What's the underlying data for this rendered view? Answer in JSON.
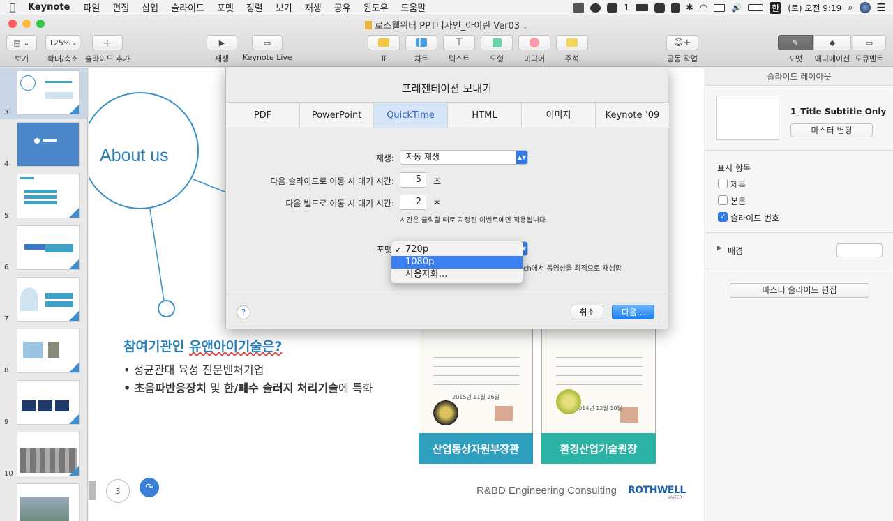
{
  "menubar": {
    "app": "Keynote",
    "items": [
      "파일",
      "편집",
      "삽입",
      "슬라이드",
      "포맷",
      "정렬",
      "보기",
      "재생",
      "공유",
      "윈도우",
      "도움말"
    ],
    "notif_count": "1",
    "ime": "한",
    "clock": "(토) 오전 9:19"
  },
  "window": {
    "title": "로스웰워터 PPT디자인_아이린 Ver03"
  },
  "toolbar": {
    "view_label": "보기",
    "zoom_value": "125%",
    "zoom_label": "확대/축소",
    "add_slide_label": "슬라이드 추가",
    "play_label": "재생",
    "keynote_live_label": "Keynote Live",
    "table_label": "표",
    "chart_label": "차트",
    "text_label": "텍스트",
    "shape_label": "도형",
    "media_label": "미디어",
    "comment_label": "주석",
    "collab_label": "공동 작업",
    "format_label": "포맷",
    "animate_label": "애니메이션",
    "document_label": "도큐멘트"
  },
  "slides": {
    "numbers": [
      "3",
      "4",
      "5",
      "6",
      "7",
      "8",
      "9",
      "10"
    ],
    "selected": "3"
  },
  "slide": {
    "about": "About us",
    "heading_pre": "참여기관인 ",
    "heading_underlined": "유앤아이기술은?",
    "bullet1": "• 성균관대 육성 전문벤처기업",
    "bullet2_bold1": "• 초음파반응장치",
    "bullet2_mid": " 및 ",
    "bullet2_bold2": "한/폐수 슬러지 처리기술",
    "bullet2_end": "에 특화",
    "cert1_band": "산업통상자원부장관",
    "cert2_band": "환경산업기술원장",
    "cert1_date": "2015년 11월 26일",
    "cert2_date": "2014년 12월 10일",
    "footer": "R&BD Engineering Consulting",
    "logo": "ROTHWELL",
    "logo_sub": "WATER",
    "page": "3"
  },
  "inspector": {
    "title": "슬라이드 레이아웃",
    "master_name": "1_Title Subtitle Only",
    "change_master": "마스터 변경",
    "show_items": "표시 항목",
    "opt_title": "제목",
    "opt_body": "본문",
    "opt_slide_number": "슬라이드 번호",
    "background": "배경",
    "edit_master": "마스터 슬라이드 편집"
  },
  "dialog": {
    "title": "프레젠테이션 보내기",
    "tabs": [
      "PDF",
      "PowerPoint",
      "QuickTime",
      "HTML",
      "이미지",
      "Keynote ’09"
    ],
    "active_tab": "QuickTime",
    "playback_label": "재생:",
    "playback_value": "자동 재생",
    "slide_delay_label": "다음 슬라이드로 이동 시 대기 시간:",
    "slide_delay_value": "5",
    "build_delay_label": "다음 빌드로 이동 시 대기 시간:",
    "build_delay_value": "2",
    "seconds": "초",
    "note": "시간은 클릭할 때로 지정된 이벤트에만 적용됩니다.",
    "format_label": "포맷",
    "format_options": [
      "720p",
      "1080p",
      "사용자화..."
    ],
    "format_checked": "720p",
    "format_highlighted": "1080p",
    "optimize_note": "ch에서 동영상을 최적으로 재생합",
    "help": "?",
    "cancel": "취소",
    "next": "다음..."
  },
  "colors": {
    "accent": "#2f7ce8",
    "slide_blue": "#2a7fb8",
    "cert_band_1": "#2f9fc0",
    "cert_band_2": "#2db3a6"
  }
}
